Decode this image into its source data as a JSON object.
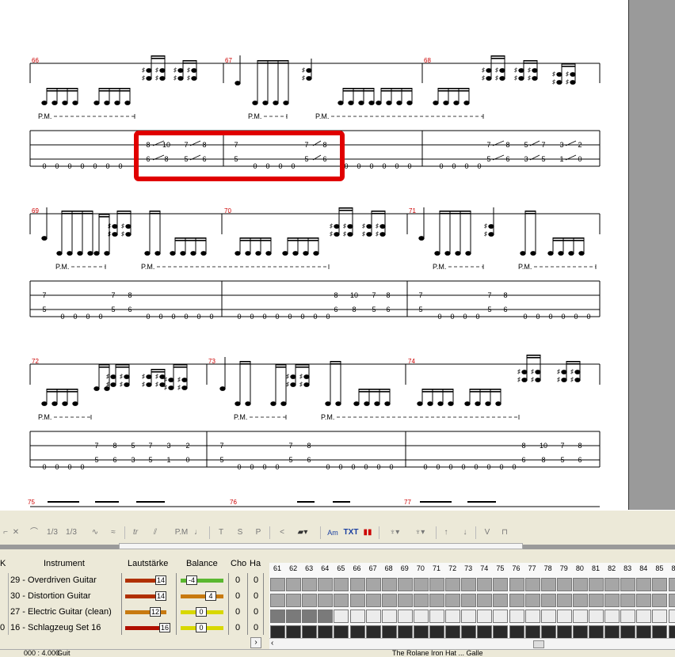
{
  "score": {
    "bars": [
      "66",
      "67",
      "68",
      "69",
      "70",
      "71",
      "72",
      "73",
      "74",
      "75",
      "76",
      "77"
    ],
    "pm_label": "P.M.",
    "tab_lines": {
      "sys1": {
        "upper": [
          "8",
          "10",
          "7",
          "8",
          "7",
          "7",
          "8",
          "7",
          "8",
          "5",
          "7",
          "3",
          "2"
        ],
        "lower": [
          "0",
          "0",
          "0",
          "0",
          "0",
          "0",
          "0",
          "6",
          "8",
          "5",
          "6",
          "5",
          "0",
          "0",
          "0",
          "0",
          "5",
          "6",
          "0",
          "0",
          "0",
          "0",
          "0",
          "0",
          "0",
          "0",
          "0",
          "0",
          "5",
          "6",
          "3",
          "5",
          "1",
          "0"
        ]
      }
    }
  },
  "toolbar": {
    "items": [
      "1/3",
      "1/3",
      "tr",
      "P.M",
      "T",
      "S",
      "P",
      "TXT",
      "V"
    ]
  },
  "tracks": {
    "headers": {
      "instrument": "Instrument",
      "volume": "Lautstärke",
      "balance": "Balance",
      "chorus": "Cho",
      "hall": "Ha"
    },
    "rows": [
      {
        "name": "29 - Overdriven Guitar",
        "volume": "14",
        "balance": "-4",
        "cho": "0",
        "ha": "0"
      },
      {
        "name": "30 - Distortion Guitar",
        "volume": "14",
        "balance": "4",
        "cho": "0",
        "ha": "0"
      },
      {
        "name": "27 - Electric Guitar (clean)",
        "volume": "12",
        "balance": "0",
        "cho": "0",
        "ha": "0"
      },
      {
        "name": "16 - Schlagzeug Set 16",
        "volume": "16",
        "balance": "0",
        "cho": "0",
        "ha": "0"
      }
    ],
    "row_prefix_last": "0"
  },
  "timeline": {
    "bars": [
      "61",
      "62",
      "63",
      "64",
      "65",
      "66",
      "67",
      "68",
      "69",
      "70",
      "71",
      "72",
      "73",
      "74",
      "75",
      "76",
      "77",
      "78",
      "79",
      "80",
      "81",
      "82",
      "83",
      "84",
      "85",
      "86"
    ]
  },
  "status": {
    "left": "000 : 4.000",
    "mid": "Guit",
    "right": "The Rolane Iron Hat ... Galle"
  },
  "colors": {
    "highlight_box": "#e00000",
    "bar_number": "#cc0000",
    "volume_slider": "#b03000",
    "balance_slider": "#d8d800"
  }
}
